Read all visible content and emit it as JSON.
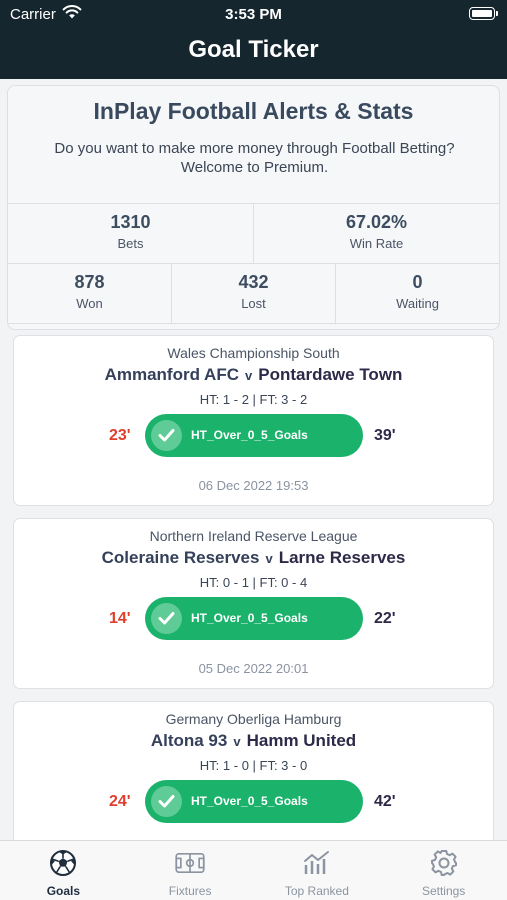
{
  "status_bar": {
    "carrier": "Carrier",
    "time": "3:53 PM"
  },
  "header": {
    "title": "Goal Ticker"
  },
  "summary": {
    "title": "InPlay Football Alerts & Stats",
    "description": "Do you want to make more money through Football Betting? Welcome to Premium.",
    "stats_row1": [
      {
        "value": "1310",
        "label": "Bets"
      },
      {
        "value": "67.02%",
        "label": "Win Rate"
      }
    ],
    "stats_row2": [
      {
        "value": "878",
        "label": "Won"
      },
      {
        "value": "432",
        "label": "Lost"
      },
      {
        "value": "0",
        "label": "Waiting"
      }
    ]
  },
  "matches": [
    {
      "league": "Wales Championship South",
      "home": "Ammanford AFC",
      "vs": "v",
      "away": "Pontardawe Town",
      "score": "HT: 1 - 2 | FT: 3 - 2",
      "alert_minute": "23'",
      "alert": "HT_Over_0_5_Goals",
      "goal_minute": "39'",
      "date": "06 Dec 2022 19:53"
    },
    {
      "league": "Northern Ireland Reserve League",
      "home": "Coleraine Reserves",
      "vs": "v",
      "away": "Larne Reserves",
      "score": "HT: 0 - 1 | FT: 0 - 4",
      "alert_minute": "14'",
      "alert": "HT_Over_0_5_Goals",
      "goal_minute": "22'",
      "date": "05 Dec 2022 20:01"
    },
    {
      "league": "Germany Oberliga Hamburg",
      "home": "Altona 93",
      "vs": "v",
      "away": "Hamm United",
      "score": "HT: 1 - 0 | FT: 3 - 0",
      "alert_minute": "24'",
      "alert": "HT_Over_0_5_Goals",
      "goal_minute": "42'",
      "date": ""
    }
  ],
  "tabs": [
    {
      "label": "Goals",
      "icon": "soccer-ball-icon",
      "active": true
    },
    {
      "label": "Fixtures",
      "icon": "pitch-icon",
      "active": false
    },
    {
      "label": "Top Ranked",
      "icon": "trend-chart-icon",
      "active": false
    },
    {
      "label": "Settings",
      "icon": "gear-icon",
      "active": false
    }
  ],
  "colors": {
    "header_bg": "#15262e",
    "alert_green": "#1bb26c",
    "minute_red": "#e03e2d"
  }
}
